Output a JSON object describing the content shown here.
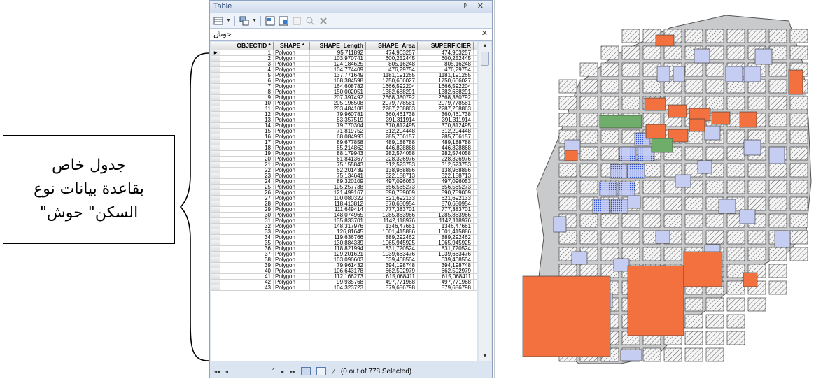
{
  "annotation": {
    "lines": [
      "جدول خاص",
      "بقاعدة بيانات  نوع",
      "السكن\" حوش\""
    ]
  },
  "table_window": {
    "title": "Table",
    "title_controls": "ᵖ ✕",
    "layer_tab": "حوش",
    "layer_close": "✕",
    "columns": [
      "OBJECTID *",
      "SHAPE *",
      "SHAPE_Length",
      "SHAPE_Area",
      "SUPERFICIER"
    ],
    "rows": [
      [
        "1",
        "Polygon",
        "95,711892",
        "474,963257",
        "474,963257"
      ],
      [
        "2",
        "Polygon",
        "103,970741",
        "600,252445",
        "600,252445"
      ],
      [
        "3",
        "Polygon",
        "124,184625",
        "805,16248",
        "805,16248"
      ],
      [
        "4",
        "Polygon",
        "104,774409",
        "476,29754",
        "476,29754"
      ],
      [
        "5",
        "Polygon",
        "137,771649",
        "1181,191265",
        "1181,191265"
      ],
      [
        "6",
        "Polygon",
        "168,384598",
        "1750,606027",
        "1750,606027"
      ],
      [
        "7",
        "Polygon",
        "164,608782",
        "1666,592204",
        "1666,592204"
      ],
      [
        "8",
        "Polygon",
        "150,002051",
        "1382,688291",
        "1382,688291"
      ],
      [
        "9",
        "Polygon",
        "207,397492",
        "2668,380792",
        "2668,380792"
      ],
      [
        "10",
        "Polygon",
        "205,196508",
        "2079,778581",
        "2079,778581"
      ],
      [
        "11",
        "Polygon",
        "203,484108",
        "2287,268863",
        "2287,268863"
      ],
      [
        "12",
        "Polygon",
        "79,960781",
        "360,461738",
        "360,461738"
      ],
      [
        "13",
        "Polygon",
        "83,357519",
        "391,311914",
        "391,311914"
      ],
      [
        "14",
        "Polygon",
        "79,770304",
        "370,812495",
        "370,812495"
      ],
      [
        "15",
        "Polygon",
        "71,819752",
        "312,204448",
        "312,204448"
      ],
      [
        "16",
        "Polygon",
        "68,084993",
        "285,706157",
        "285,706157"
      ],
      [
        "17",
        "Polygon",
        "89,677858",
        "489,188788",
        "489,188788"
      ],
      [
        "18",
        "Polygon",
        "85,214862",
        "446,828868",
        "446,828868"
      ],
      [
        "19",
        "Polygon",
        "88,179943",
        "282,574058",
        "282,574058"
      ],
      [
        "20",
        "Polygon",
        "61,841367",
        "228,326976",
        "228,326976"
      ],
      [
        "21",
        "Polygon",
        "75,155843",
        "312,523753",
        "312,523753"
      ],
      [
        "22",
        "Polygon",
        "62,201439",
        "138,968856",
        "138,968856"
      ],
      [
        "23",
        "Polygon",
        "75,134641",
        "322,158713",
        "322,158713"
      ],
      [
        "24",
        "Polygon",
        "89,320109",
        "497,096053",
        "497,096053"
      ],
      [
        "25",
        "Polygon",
        "105,257738",
        "656,565273",
        "656,565273"
      ],
      [
        "26",
        "Polygon",
        "121,499167",
        "890,759009",
        "890,759009"
      ],
      [
        "27",
        "Polygon",
        "100,080322",
        "621,692133",
        "621,692133"
      ],
      [
        "28",
        "Polygon",
        "118,413812",
        "870,650954",
        "870,650954"
      ],
      [
        "29",
        "Polygon",
        "111,649414",
        "777,383701",
        "777,383701"
      ],
      [
        "30",
        "Polygon",
        "148,074965",
        "1285,863966",
        "1285,863966"
      ],
      [
        "31",
        "Polygon",
        "135,833701",
        "1142,118976",
        "1142,118976"
      ],
      [
        "32",
        "Polygon",
        "148,317976",
        "1346,47661",
        "1346,47661"
      ],
      [
        "33",
        "Polygon",
        "126,81645",
        "1001,415886",
        "1001,415886"
      ],
      [
        "34",
        "Polygon",
        "119,636766",
        "889,292462",
        "889,292462"
      ],
      [
        "35",
        "Polygon",
        "130,884339",
        "1065,945925",
        "1065,945925"
      ],
      [
        "36",
        "Polygon",
        "118,821994",
        "831,720524",
        "831,720524"
      ],
      [
        "37",
        "Polygon",
        "129,201621",
        "1039,663476",
        "1039,663476"
      ],
      [
        "38",
        "Polygon",
        "103,090603",
        "639,468504",
        "639,468504"
      ],
      [
        "39",
        "Polygon",
        "79,961432",
        "394,198748",
        "394,198748"
      ],
      [
        "40",
        "Polygon",
        "106,643178",
        "662,592979",
        "662,592979"
      ],
      [
        "41",
        "Polygon",
        "112,166273",
        "615,068411",
        "615,068411"
      ],
      [
        "42",
        "Polygon",
        "99,935768",
        "497,771968",
        "497,771968"
      ],
      [
        "43",
        "Polygon",
        "104,323723",
        "579,686798",
        "579,686798"
      ]
    ],
    "status": {
      "first": "◂◂",
      "prev": "◂",
      "record": "1",
      "next": "▸",
      "last": "▸▸",
      "selected": "(0 out of 778 Selected)"
    }
  },
  "map": {
    "colors": {
      "background": "#ffffff",
      "block_grey": "#c9cacb",
      "hatch": "#5b5b5b",
      "parcel_blue": "#c6cdf3",
      "parcel_dotted": "#3157d6",
      "orange": "#f2713f",
      "green": "#6fae6a"
    }
  }
}
